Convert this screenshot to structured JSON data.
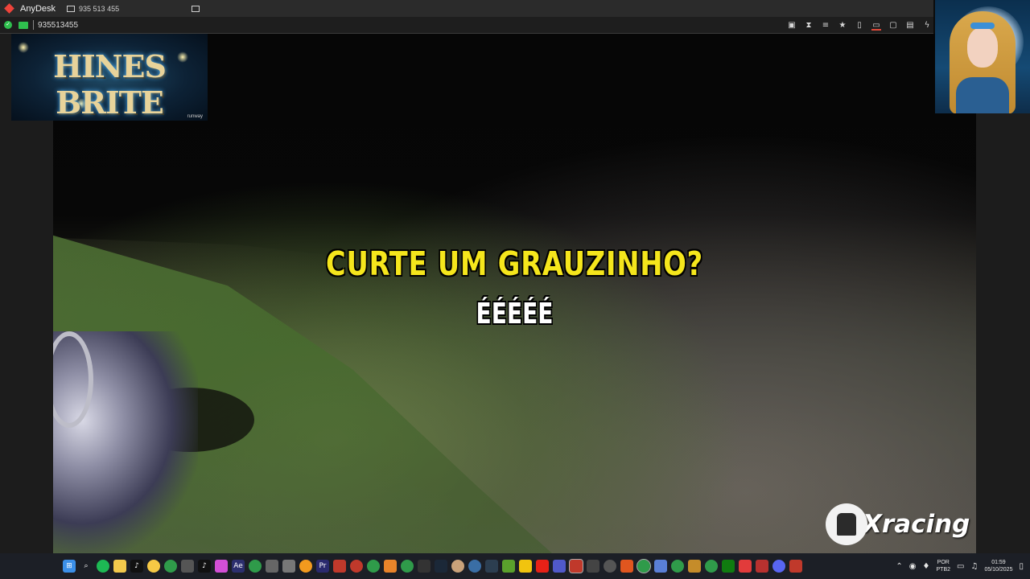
{
  "titlebar": {
    "app_name": "AnyDesk",
    "session_tab": "935 513 455"
  },
  "addressbar": {
    "address": "935513455"
  },
  "overlay": {
    "brand_title": "HINES BRITE",
    "brand_small": "runway",
    "xracing_text": "Xracing"
  },
  "video": {
    "caption_line1": "CURTE UM GRAUZINHO?",
    "caption_line2": "ÉÉÉÉÉ"
  },
  "tray": {
    "lang": "POR",
    "layout": "PTB2",
    "time": "01:59",
    "date": "05/10/2025"
  },
  "colors": {
    "anydesk_red": "#ef443b",
    "caption_yellow": "#f5e61c",
    "ok_green": "#2fbf4e"
  }
}
